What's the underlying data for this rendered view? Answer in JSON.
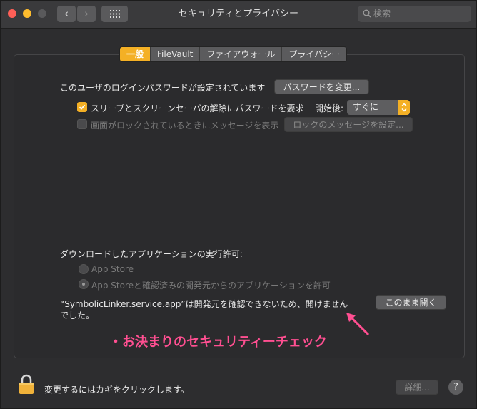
{
  "window": {
    "title": "セキュリティとプライバシー"
  },
  "toolbar": {
    "back": "‹",
    "forward": "›",
    "search_placeholder": "検索"
  },
  "tabs": [
    {
      "label": "一般",
      "active": true
    },
    {
      "label": "FileVault",
      "active": false
    },
    {
      "label": "ファイアウォール",
      "active": false
    },
    {
      "label": "プライバシー",
      "active": false
    }
  ],
  "general": {
    "password_text": "このユーザのログインパスワードが設定されています",
    "change_password_button": "パスワードを変更...",
    "require_password_label": "スリープとスクリーンセーバの解除にパスワードを要求",
    "require_password_checked": true,
    "start_label": "開始後:",
    "start_value": "すぐに",
    "lock_message_label": "画面がロックされているときにメッセージを表示",
    "lock_message_checked": false,
    "lock_message_button": "ロックのメッセージを設定..."
  },
  "downloads": {
    "heading": "ダウンロードしたアプリケーションの実行許可:",
    "option_app_store": "App Store",
    "option_identified": "App Storeと確認済みの開発元からのアプリケーションを許可",
    "blocked_line1": "“SymbolicLinker.service.app”は開発元を確認できないため、開けません",
    "blocked_line2": "でした。",
    "open_anyway_button": "このまま開く"
  },
  "annotation": "・お決まりのセキュリティーチェック",
  "footer": {
    "lock_text": "変更するにはカギをクリックします。",
    "advanced_button": "詳細...",
    "help": "?"
  },
  "colors": {
    "accent": "#f4b025",
    "annotation": "#ff4f91"
  }
}
